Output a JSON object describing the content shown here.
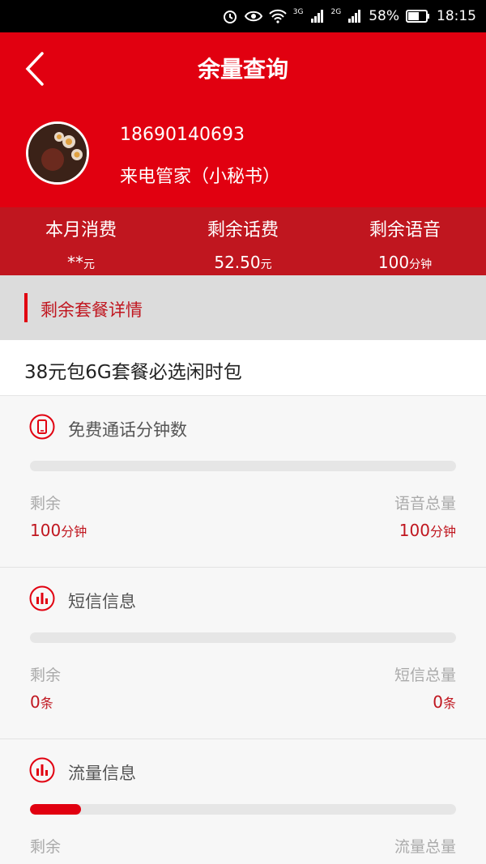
{
  "status_bar": {
    "battery": "58%",
    "time": "18:15",
    "network_1": "3G",
    "network_2": "2G"
  },
  "header": {
    "title": "余量查询",
    "phone": "18690140693",
    "user_name": "来电管家（小秘书）"
  },
  "stats": [
    {
      "label": "本月消费",
      "value": "**",
      "unit": "元"
    },
    {
      "label": "剩余话费",
      "value": "52.50",
      "unit": "元"
    },
    {
      "label": "剩余语音",
      "value": "100",
      "unit": "分钟"
    }
  ],
  "section_title": "剩余套餐详情",
  "package_name": "38元包6G套餐必选闲时包",
  "cards": [
    {
      "title": "免费通话分钟数",
      "icon": "phone-icon",
      "left_label": "剩余",
      "left_value": "100",
      "left_unit": "分钟",
      "right_label": "语音总量",
      "right_value": "100",
      "right_unit": "分钟",
      "progress": 0
    },
    {
      "title": "短信信息",
      "icon": "bar-chart-icon",
      "left_label": "剩余",
      "left_value": "0",
      "left_unit": "条",
      "right_label": "短信总量",
      "right_value": "0",
      "right_unit": "条",
      "progress": 0
    },
    {
      "title": "流量信息",
      "icon": "bar-chart-icon",
      "left_label": "剩余",
      "right_label": "流量总量",
      "progress": 0.12
    }
  ],
  "colors": {
    "brand_red": "#e10010",
    "stats_red": "#c0161f"
  }
}
